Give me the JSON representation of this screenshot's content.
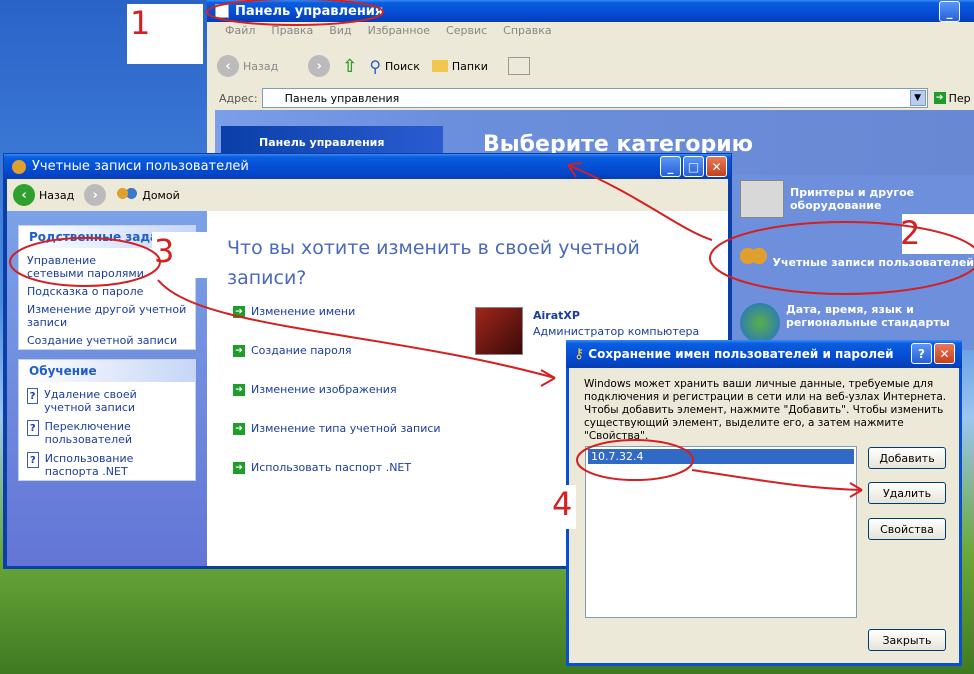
{
  "cp_window": {
    "title": "Панель управления",
    "menu": [
      "Файл",
      "Правка",
      "Вид",
      "Избранное",
      "Сервис",
      "Справка"
    ],
    "toolbar": {
      "back": "Назад",
      "search": "Поиск",
      "folders": "Папки"
    },
    "address_label": "Адрес:",
    "address_value": "Панель управления",
    "go_label": "Пер",
    "side_panel_title": "Панель управления",
    "heading": "Выберите категорию",
    "categories": [
      {
        "label": "Принтеры и другое оборудование"
      },
      {
        "label": "Учетные записи пользователей"
      },
      {
        "label": "Дата, время, язык и региональные стандарты"
      }
    ]
  },
  "ua_window": {
    "title": "Учетные записи пользователей",
    "toolbar": {
      "back": "Назад",
      "home": "Домой"
    },
    "related_title": "Родственные задачи",
    "related_items": [
      "Управление сетевыми паролями",
      "Подсказка о пароле",
      "Изменение другой учетной записи",
      "Создание учетной записи"
    ],
    "learn_title": "Обучение",
    "learn_items": [
      "Удаление своей учетной записи",
      "Переключение пользователей",
      "Использование паспорта .NET"
    ],
    "heading": "Что вы хотите изменить в своей учетной записи?",
    "actions": [
      "Изменение имени",
      "Создание пароля",
      "Изменение изображения",
      "Изменение типа учетной записи",
      "Использовать паспорт .NET"
    ],
    "user_name": "AiratXP",
    "user_role": "Администратор компьютера"
  },
  "dialog": {
    "title": "Сохранение имен пользователей и паролей",
    "description": "Windows может хранить ваши личные данные, требуемые для подключения и регистрации в сети или на веб-узлах Интернета. Чтобы добавить элемент, нажмите \"Добавить\". Чтобы изменить существующий элемент, выделите его, а затем нажмите \"Свойства\".",
    "list_items": [
      "10.7.32.4"
    ],
    "buttons": {
      "add": "Добавить",
      "remove": "Удалить",
      "props": "Свойства",
      "close": "Закрыть"
    }
  },
  "annotations": [
    "1",
    "2",
    "3",
    "4"
  ],
  "colors": {
    "annotation": "#d42020",
    "xp_blue": "#0550d6",
    "link": "#1a3d9c"
  }
}
